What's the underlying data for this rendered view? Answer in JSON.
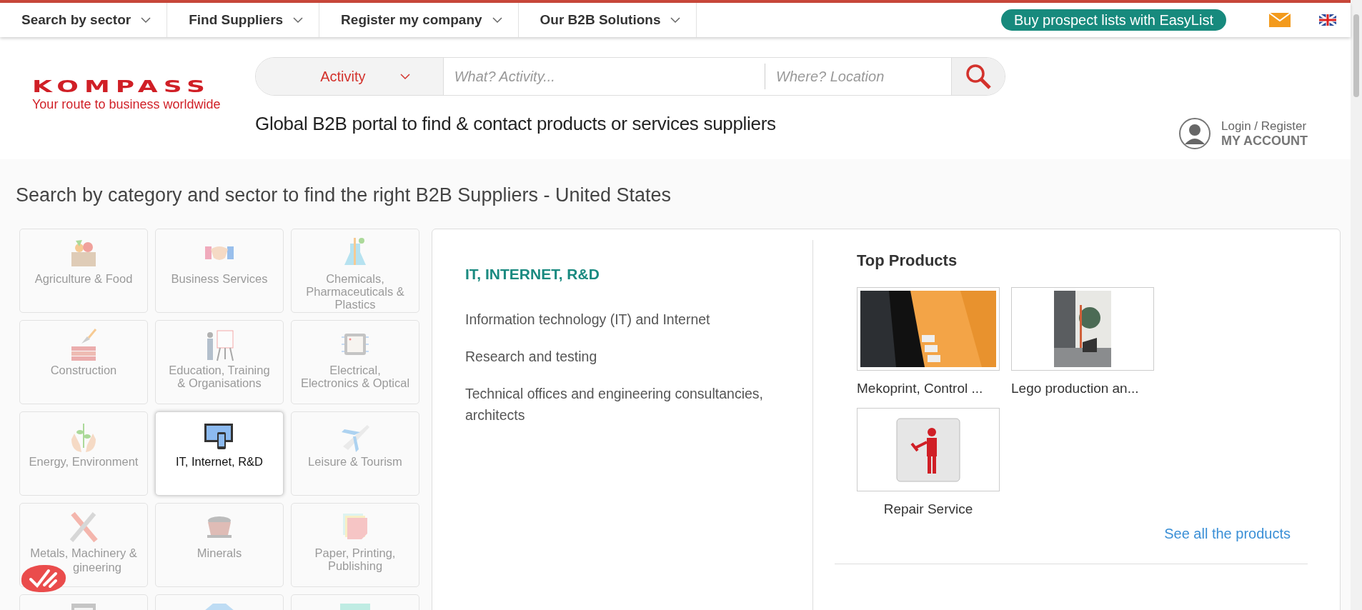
{
  "top_nav": {
    "items": [
      {
        "label": "Search by sector"
      },
      {
        "label": "Find Suppliers"
      },
      {
        "label": "Register my company"
      },
      {
        "label": "Our B2B Solutions"
      }
    ],
    "easylist_button": "Buy prospect lists with EasyList"
  },
  "header": {
    "logo": {
      "name": "KOMPASS",
      "tagline": "Your route to business worldwide"
    },
    "search": {
      "activity": "Activity",
      "what_placeholder": "What? Activity...",
      "where_placeholder": "Where? Location"
    },
    "tagline": "Global B2B portal to find & contact products or services suppliers",
    "account": {
      "login": "Login / Register",
      "label": "MY ACCOUNT"
    }
  },
  "section_title": "Search by category and sector to find the right B2B Suppliers - United States",
  "categories": [
    {
      "label": "Agriculture & Food",
      "selected": false
    },
    {
      "label": "Business Services",
      "selected": false
    },
    {
      "label": "Chemicals, Pharmaceuticals & Plastics",
      "selected": false
    },
    {
      "label": "Construction",
      "selected": false
    },
    {
      "label": "Education, Training & Organisations",
      "selected": false
    },
    {
      "label": "Electrical, Electronics & Optical",
      "selected": false
    },
    {
      "label": "Energy, Environment",
      "selected": false
    },
    {
      "label": "IT, Internet, R&D",
      "selected": true
    },
    {
      "label": "Leisure & Tourism",
      "selected": false
    },
    {
      "label": "Metals, Machinery &",
      "label_line2": "gineering",
      "selected": false
    },
    {
      "label": "Minerals",
      "selected": false
    },
    {
      "label": "Paper, Printing, Publishing",
      "selected": false
    },
    {
      "selected": false
    },
    {
      "selected": false
    },
    {
      "selected": false
    }
  ],
  "sector_panel": {
    "heading": "IT, INTERNET, R&D",
    "subsectors": [
      "Information technology (IT) and Internet",
      "Research and testing",
      "Technical offices and engineering consultancies, architects"
    ],
    "top_products": {
      "title": "Top Products",
      "products": [
        {
          "caption": "Mekoprint, Control ...",
          "kind": "picture"
        },
        {
          "caption": "Lego production an...",
          "kind": "picture"
        },
        {
          "caption": "Repair Service",
          "kind": "picture"
        }
      ],
      "see_all": "See all the products"
    }
  }
}
